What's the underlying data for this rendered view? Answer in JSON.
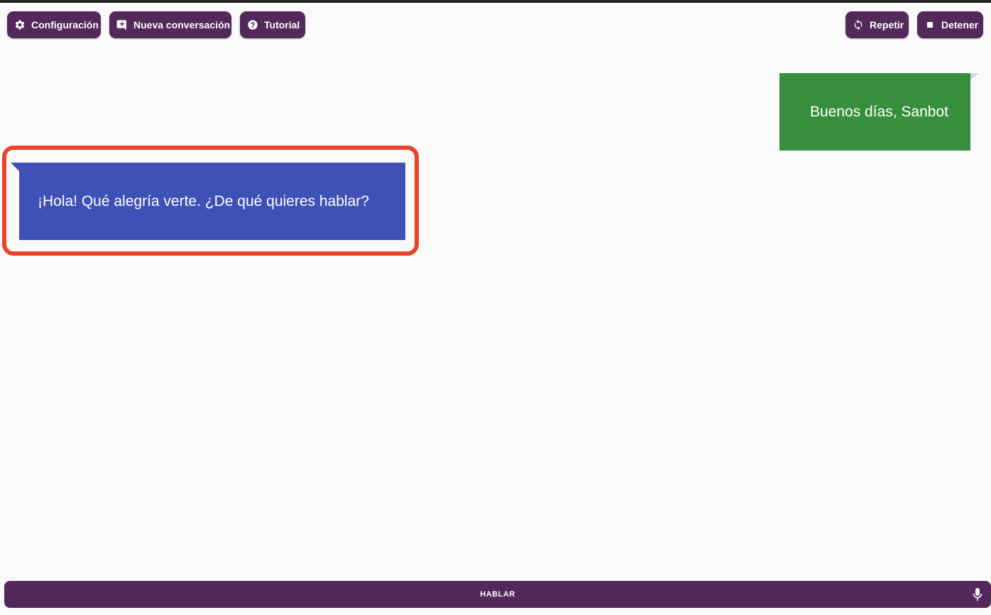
{
  "toolbar": {
    "config_label": "Configuración",
    "new_chat_label": "Nueva conversación",
    "tutorial_label": "Tutorial",
    "repeat_label": "Repetir",
    "stop_label": "Detener"
  },
  "messages": {
    "user": "Buenos días, Sanbot",
    "bot": "¡Hola! Qué alegría verte. ¿De qué quieres hablar?"
  },
  "talk_button": {
    "label": "HABLAR"
  },
  "icons": [
    "gear-icon",
    "add-comment-icon",
    "help-icon",
    "refresh-icon",
    "stop-icon",
    "mic-icon"
  ],
  "colors": {
    "button": "#53285a",
    "user_bubble": "#388e3c",
    "bot_bubble": "#3f51b5",
    "highlight": "#e8442c",
    "background": "#fafafa"
  }
}
